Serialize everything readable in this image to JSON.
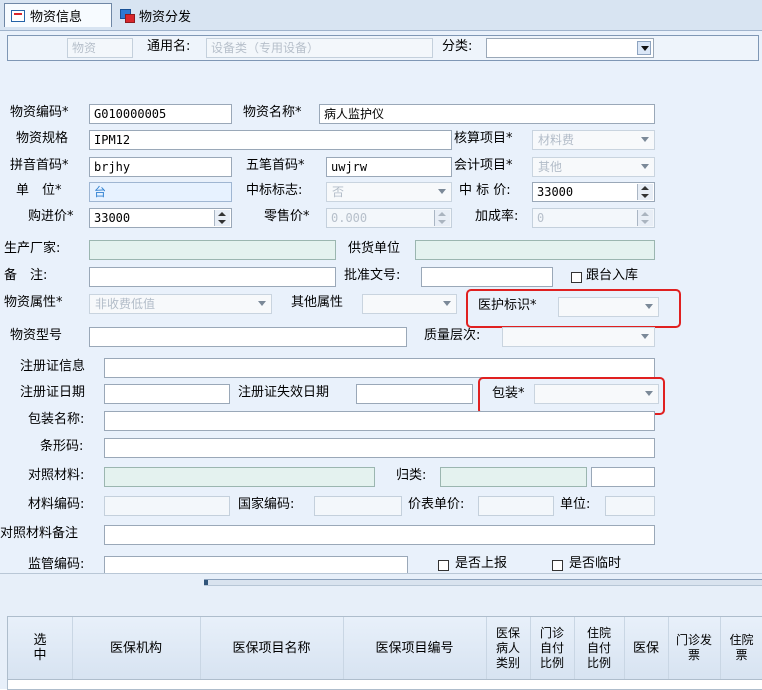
{
  "tabs": [
    {
      "label": "物资信息"
    },
    {
      "label": "物资分发"
    }
  ],
  "header": {
    "wuzi_label": "物资",
    "general_name_label": "通用名:",
    "general_name_value": "设备类（专用设备）",
    "category_label": "分类:"
  },
  "form": {
    "code_label": "物资编码*",
    "code_value": "G010000005",
    "name_label": "物资名称*",
    "name_value": "病人监护仪",
    "spec_label": "物资规格",
    "spec_value": "IPM12",
    "account_item_label": "核算项目*",
    "account_item_value": "材料费",
    "pinyin_label": "拼音首码*",
    "pinyin_value": "brjhy",
    "wubi_label": "五笔首码*",
    "wubi_value": "uwjrw",
    "accounting_item_label": "会计项目*",
    "accounting_item_value": "其他",
    "unit_label": "单　位*",
    "unit_value": "台",
    "bid_flag_label": "中标标志:",
    "bid_flag_value": "否",
    "bid_price_label": "中 标 价:",
    "bid_price_value": "33000",
    "purchase_price_label": "购进价*",
    "purchase_price_value": "33000",
    "retail_price_label": "零售价*",
    "retail_price_value": "0.000",
    "markup_label": "加成率:",
    "markup_value": "0",
    "manufacturer_label": "生产厂家:",
    "supplier_label": "供货单位",
    "remark_label": "备　注:",
    "approval_label": "批准文号:",
    "follow_label": "跟台入库",
    "material_attr_label": "物资属性*",
    "material_attr_value": "非收费低值",
    "other_attr_label": "其他属性",
    "medical_flag_label": "医护标识*",
    "model_label": "物资型号",
    "quality_label": "质量层次:",
    "cert_info_label": "注册证信息",
    "cert_date_label": "注册证日期",
    "cert_expire_label": "注册证失效日期",
    "package_label": "包装*",
    "package_name_label": "包装名称:",
    "barcode_label": "条形码:",
    "control_material_label": "对照材料:",
    "classify_label": "归类:",
    "material_code_label": "材料编码:",
    "national_code_label": "国家编码:",
    "price_unit_label": "价表单价:",
    "unit2_label": "单位:",
    "control_note_label": "对照材料备注",
    "supervision_label": "监管编码:",
    "report_label": "是否上报",
    "temporary_label": "是否临时"
  },
  "grid_headers": [
    {
      "label": "选\n中"
    },
    {
      "label": "医保机构"
    },
    {
      "label": "医保项目名称"
    },
    {
      "label": "医保项目编号"
    },
    {
      "label": "医保\n病人\n类别"
    },
    {
      "label": "门诊\n自付\n比例"
    },
    {
      "label": "住院\n自付\n比例"
    },
    {
      "label": "医保"
    },
    {
      "label": "门诊发\n票"
    },
    {
      "label": "住院\n票"
    }
  ],
  "colors": {
    "highlight": "#e02020",
    "disabled_text": "#b7c0cb",
    "accent": "#2f80d1"
  }
}
